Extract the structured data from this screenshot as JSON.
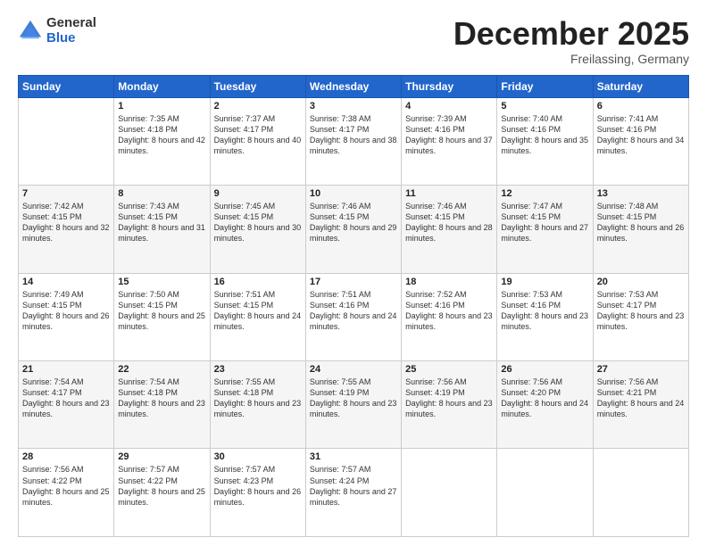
{
  "logo": {
    "general": "General",
    "blue": "Blue"
  },
  "header": {
    "month": "December 2025",
    "location": "Freilassing, Germany"
  },
  "weekdays": [
    "Sunday",
    "Monday",
    "Tuesday",
    "Wednesday",
    "Thursday",
    "Friday",
    "Saturday"
  ],
  "weeks": [
    [
      {
        "day": "",
        "sunrise": "",
        "sunset": "",
        "daylight": ""
      },
      {
        "day": "1",
        "sunrise": "Sunrise: 7:35 AM",
        "sunset": "Sunset: 4:18 PM",
        "daylight": "Daylight: 8 hours and 42 minutes."
      },
      {
        "day": "2",
        "sunrise": "Sunrise: 7:37 AM",
        "sunset": "Sunset: 4:17 PM",
        "daylight": "Daylight: 8 hours and 40 minutes."
      },
      {
        "day": "3",
        "sunrise": "Sunrise: 7:38 AM",
        "sunset": "Sunset: 4:17 PM",
        "daylight": "Daylight: 8 hours and 38 minutes."
      },
      {
        "day": "4",
        "sunrise": "Sunrise: 7:39 AM",
        "sunset": "Sunset: 4:16 PM",
        "daylight": "Daylight: 8 hours and 37 minutes."
      },
      {
        "day": "5",
        "sunrise": "Sunrise: 7:40 AM",
        "sunset": "Sunset: 4:16 PM",
        "daylight": "Daylight: 8 hours and 35 minutes."
      },
      {
        "day": "6",
        "sunrise": "Sunrise: 7:41 AM",
        "sunset": "Sunset: 4:16 PM",
        "daylight": "Daylight: 8 hours and 34 minutes."
      }
    ],
    [
      {
        "day": "7",
        "sunrise": "Sunrise: 7:42 AM",
        "sunset": "Sunset: 4:15 PM",
        "daylight": "Daylight: 8 hours and 32 minutes."
      },
      {
        "day": "8",
        "sunrise": "Sunrise: 7:43 AM",
        "sunset": "Sunset: 4:15 PM",
        "daylight": "Daylight: 8 hours and 31 minutes."
      },
      {
        "day": "9",
        "sunrise": "Sunrise: 7:45 AM",
        "sunset": "Sunset: 4:15 PM",
        "daylight": "Daylight: 8 hours and 30 minutes."
      },
      {
        "day": "10",
        "sunrise": "Sunrise: 7:46 AM",
        "sunset": "Sunset: 4:15 PM",
        "daylight": "Daylight: 8 hours and 29 minutes."
      },
      {
        "day": "11",
        "sunrise": "Sunrise: 7:46 AM",
        "sunset": "Sunset: 4:15 PM",
        "daylight": "Daylight: 8 hours and 28 minutes."
      },
      {
        "day": "12",
        "sunrise": "Sunrise: 7:47 AM",
        "sunset": "Sunset: 4:15 PM",
        "daylight": "Daylight: 8 hours and 27 minutes."
      },
      {
        "day": "13",
        "sunrise": "Sunrise: 7:48 AM",
        "sunset": "Sunset: 4:15 PM",
        "daylight": "Daylight: 8 hours and 26 minutes."
      }
    ],
    [
      {
        "day": "14",
        "sunrise": "Sunrise: 7:49 AM",
        "sunset": "Sunset: 4:15 PM",
        "daylight": "Daylight: 8 hours and 26 minutes."
      },
      {
        "day": "15",
        "sunrise": "Sunrise: 7:50 AM",
        "sunset": "Sunset: 4:15 PM",
        "daylight": "Daylight: 8 hours and 25 minutes."
      },
      {
        "day": "16",
        "sunrise": "Sunrise: 7:51 AM",
        "sunset": "Sunset: 4:15 PM",
        "daylight": "Daylight: 8 hours and 24 minutes."
      },
      {
        "day": "17",
        "sunrise": "Sunrise: 7:51 AM",
        "sunset": "Sunset: 4:16 PM",
        "daylight": "Daylight: 8 hours and 24 minutes."
      },
      {
        "day": "18",
        "sunrise": "Sunrise: 7:52 AM",
        "sunset": "Sunset: 4:16 PM",
        "daylight": "Daylight: 8 hours and 23 minutes."
      },
      {
        "day": "19",
        "sunrise": "Sunrise: 7:53 AM",
        "sunset": "Sunset: 4:16 PM",
        "daylight": "Daylight: 8 hours and 23 minutes."
      },
      {
        "day": "20",
        "sunrise": "Sunrise: 7:53 AM",
        "sunset": "Sunset: 4:17 PM",
        "daylight": "Daylight: 8 hours and 23 minutes."
      }
    ],
    [
      {
        "day": "21",
        "sunrise": "Sunrise: 7:54 AM",
        "sunset": "Sunset: 4:17 PM",
        "daylight": "Daylight: 8 hours and 23 minutes."
      },
      {
        "day": "22",
        "sunrise": "Sunrise: 7:54 AM",
        "sunset": "Sunset: 4:18 PM",
        "daylight": "Daylight: 8 hours and 23 minutes."
      },
      {
        "day": "23",
        "sunrise": "Sunrise: 7:55 AM",
        "sunset": "Sunset: 4:18 PM",
        "daylight": "Daylight: 8 hours and 23 minutes."
      },
      {
        "day": "24",
        "sunrise": "Sunrise: 7:55 AM",
        "sunset": "Sunset: 4:19 PM",
        "daylight": "Daylight: 8 hours and 23 minutes."
      },
      {
        "day": "25",
        "sunrise": "Sunrise: 7:56 AM",
        "sunset": "Sunset: 4:19 PM",
        "daylight": "Daylight: 8 hours and 23 minutes."
      },
      {
        "day": "26",
        "sunrise": "Sunrise: 7:56 AM",
        "sunset": "Sunset: 4:20 PM",
        "daylight": "Daylight: 8 hours and 24 minutes."
      },
      {
        "day": "27",
        "sunrise": "Sunrise: 7:56 AM",
        "sunset": "Sunset: 4:21 PM",
        "daylight": "Daylight: 8 hours and 24 minutes."
      }
    ],
    [
      {
        "day": "28",
        "sunrise": "Sunrise: 7:56 AM",
        "sunset": "Sunset: 4:22 PM",
        "daylight": "Daylight: 8 hours and 25 minutes."
      },
      {
        "day": "29",
        "sunrise": "Sunrise: 7:57 AM",
        "sunset": "Sunset: 4:22 PM",
        "daylight": "Daylight: 8 hours and 25 minutes."
      },
      {
        "day": "30",
        "sunrise": "Sunrise: 7:57 AM",
        "sunset": "Sunset: 4:23 PM",
        "daylight": "Daylight: 8 hours and 26 minutes."
      },
      {
        "day": "31",
        "sunrise": "Sunrise: 7:57 AM",
        "sunset": "Sunset: 4:24 PM",
        "daylight": "Daylight: 8 hours and 27 minutes."
      },
      {
        "day": "",
        "sunrise": "",
        "sunset": "",
        "daylight": ""
      },
      {
        "day": "",
        "sunrise": "",
        "sunset": "",
        "daylight": ""
      },
      {
        "day": "",
        "sunrise": "",
        "sunset": "",
        "daylight": ""
      }
    ]
  ]
}
